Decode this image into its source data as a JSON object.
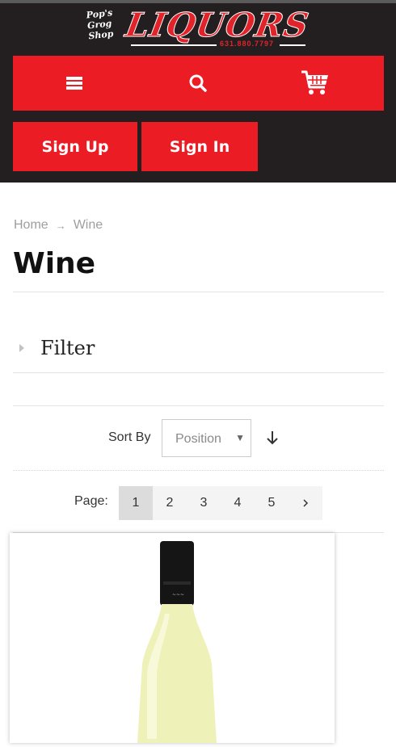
{
  "header": {
    "logo_script": [
      "Pop's",
      "Grog",
      "Shop"
    ],
    "logo_brand": "LIQUORS",
    "logo_phone": "631.880.7797"
  },
  "nav": {
    "menu_icon": "hamburger-menu-icon",
    "search_icon": "search-icon",
    "cart_icon": "shopping-cart-icon"
  },
  "auth": {
    "sign_up": "Sign Up",
    "sign_in": "Sign In"
  },
  "breadcrumb": {
    "home": "Home",
    "current": "Wine"
  },
  "page_title": "Wine",
  "filter": {
    "label": "Filter"
  },
  "sort": {
    "label": "Sort By",
    "selected": "Position",
    "direction_icon": "arrow-down-icon"
  },
  "pager": {
    "label": "Page:",
    "pages": [
      "1",
      "2",
      "3",
      "4",
      "5"
    ],
    "current": "1",
    "next_icon": "chevron-right-icon"
  },
  "colors": {
    "header_bg": "#231f20",
    "brand_red": "#ec1c24",
    "text_dark": "#111111",
    "muted": "#9e9e9e"
  }
}
